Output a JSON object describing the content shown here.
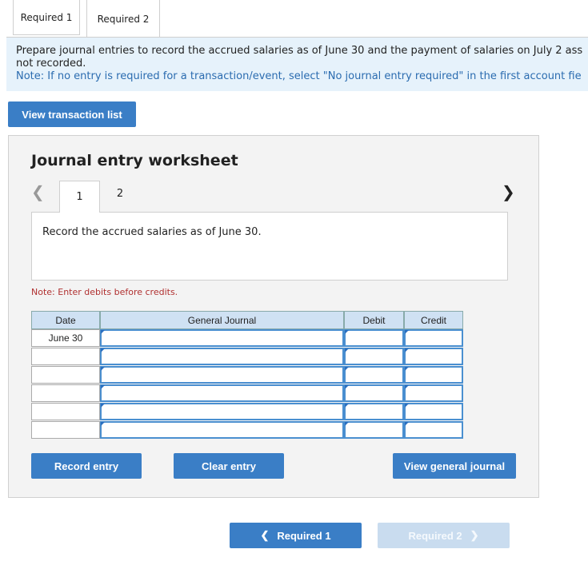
{
  "tabs": [
    "Required 1",
    "Required 2"
  ],
  "instructions": {
    "line1": "Prepare journal entries to record the accrued salaries as of June 30 and the payment of salaries on July 2 ass",
    "line2": "not recorded.",
    "note": "Note: If no entry is required for a transaction/event, select \"No journal entry required\" in the first account fie"
  },
  "buttons": {
    "view_transactions": "View transaction list",
    "record_entry": "Record entry",
    "clear_entry": "Clear entry",
    "view_general_journal": "View general journal",
    "prev_required": "Required 1",
    "next_required": "Required 2"
  },
  "worksheet": {
    "title": "Journal entry worksheet",
    "pages": [
      "1",
      "2"
    ],
    "description": "Record the accrued salaries as of June 30.",
    "note": "Note: Enter debits before credits."
  },
  "journal": {
    "headers": [
      "Date",
      "General Journal",
      "Debit",
      "Credit"
    ],
    "rows": [
      {
        "date": "June 30"
      },
      {
        "date": ""
      },
      {
        "date": ""
      },
      {
        "date": ""
      },
      {
        "date": ""
      },
      {
        "date": ""
      }
    ]
  },
  "icons": {
    "left": "chevron-left-icon",
    "right": "chevron-right-icon"
  }
}
